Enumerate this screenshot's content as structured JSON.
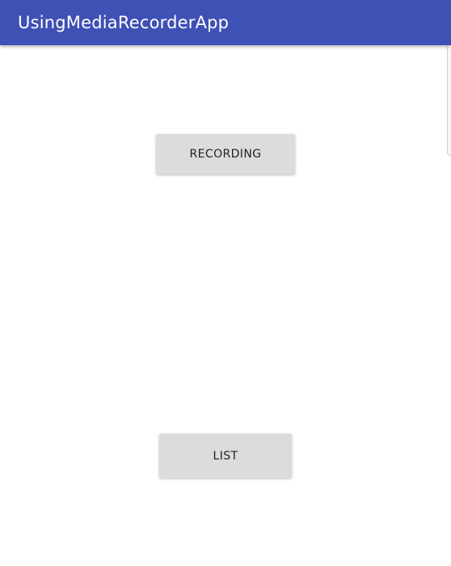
{
  "app_bar": {
    "title": "UsingMediaRecorderApp",
    "background_color": "#3f51b5",
    "title_color": "#ffffff"
  },
  "main": {
    "recording_button_label": "RECORDING",
    "list_button_label": "LIST",
    "button_color": "#dcdcdc"
  }
}
